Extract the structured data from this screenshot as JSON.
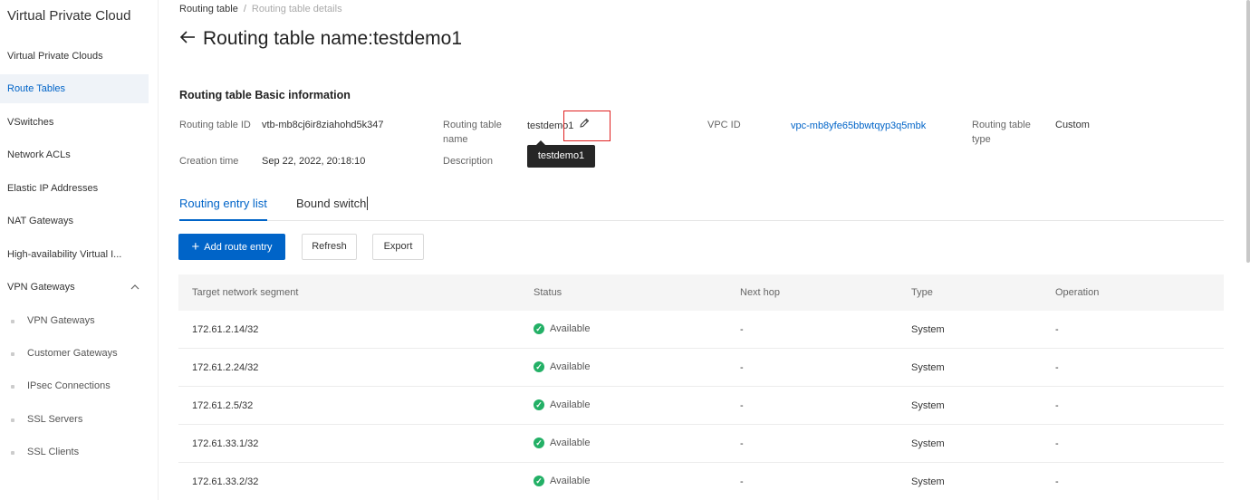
{
  "sidebar": {
    "title": "Virtual Private Cloud",
    "items": [
      {
        "label": "Virtual Private Clouds"
      },
      {
        "label": "Route Tables",
        "active": true
      },
      {
        "label": "VSwitches"
      },
      {
        "label": "Network ACLs"
      },
      {
        "label": "Elastic IP Addresses"
      },
      {
        "label": "NAT Gateways"
      },
      {
        "label": "High-availability Virtual I..."
      },
      {
        "label": "VPN Gateways",
        "icon": "chevron-up-icon"
      }
    ],
    "sub_items": [
      {
        "label": "VPN Gateways"
      },
      {
        "label": "Customer Gateways"
      },
      {
        "label": "IPsec Connections"
      },
      {
        "label": "SSL Servers"
      },
      {
        "label": "SSL Clients"
      }
    ]
  },
  "breadcrumb": {
    "parent": "Routing table",
    "separator": "/",
    "current": "Routing table details"
  },
  "page": {
    "title": "Routing table name:testdemo1"
  },
  "basic_info": {
    "section_title": "Routing table Basic information",
    "route_table_id_label": "Routing table ID",
    "route_table_id_value": "vtb-mb8cj6ir8ziahohd5k347",
    "name_label_1": "Routing table",
    "name_label_2": "name",
    "name_value": "testdemo1",
    "vpc_id_label": "VPC ID",
    "vpc_id_value": "vpc-mb8yfe65bbwtqyp3q5mbk",
    "type_label_1": "Routing table",
    "type_label_2": "type",
    "type_value": "Custom",
    "creation_time_label": "Creation time",
    "creation_time_value": "Sep 22, 2022, 20:18:10",
    "description_label": "Description",
    "tooltip_text": "testdemo1"
  },
  "tabs": [
    {
      "label": "Routing entry list",
      "active": true
    },
    {
      "label": "Bound switch",
      "active": false
    }
  ],
  "toolbar": {
    "add_label": "Add route entry",
    "refresh_label": "Refresh",
    "export_label": "Export"
  },
  "table": {
    "columns": [
      "Target network segment",
      "Status",
      "Next hop",
      "Type",
      "Operation"
    ],
    "rows": [
      {
        "segment": "172.61.2.14/32",
        "status": "Available",
        "next_hop": "-",
        "type": "System",
        "operation": "-"
      },
      {
        "segment": "172.61.2.24/32",
        "status": "Available",
        "next_hop": "-",
        "type": "System",
        "operation": "-"
      },
      {
        "segment": "172.61.2.5/32",
        "status": "Available",
        "next_hop": "-",
        "type": "System",
        "operation": "-"
      },
      {
        "segment": "172.61.33.1/32",
        "status": "Available",
        "next_hop": "-",
        "type": "System",
        "operation": "-"
      },
      {
        "segment": "172.61.33.2/32",
        "status": "Available",
        "next_hop": "-",
        "type": "System",
        "operation": "-"
      }
    ]
  },
  "colors": {
    "accent": "#0064c8",
    "success": "#23b066",
    "highlight": "#e02020"
  }
}
